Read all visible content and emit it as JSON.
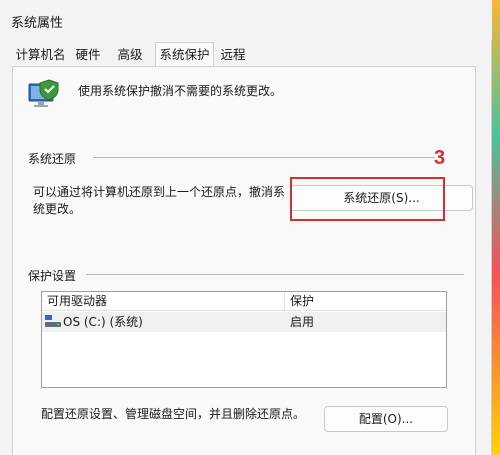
{
  "window": {
    "title": "系统属性"
  },
  "tabs": [
    {
      "label": "计算机名"
    },
    {
      "label": "硬件"
    },
    {
      "label": "高级"
    },
    {
      "label": "系统保护"
    },
    {
      "label": "远程"
    }
  ],
  "active_tab": "系统保护",
  "intro": {
    "text": "使用系统保护撤消不需要的系统更改。"
  },
  "system_restore": {
    "group_title": "系统还原",
    "description": "可以通过将计算机还原到上一个还原点，撤消系统更改。",
    "button_label": "系统还原(S)...",
    "annotation": "3"
  },
  "protection_settings": {
    "group_title": "保护设置",
    "columns": [
      "可用驱动器",
      "保护"
    ],
    "rows": [
      {
        "drive": "OS (C:) (系统)",
        "protection": "启用"
      }
    ],
    "config_text": "配置还原设置、管理磁盘空间，并且删除还原点。",
    "config_button_label": "配置(O)..."
  },
  "colors": {
    "annotation_red": "#d32f2f",
    "selected_row": "#f0f0f0"
  }
}
